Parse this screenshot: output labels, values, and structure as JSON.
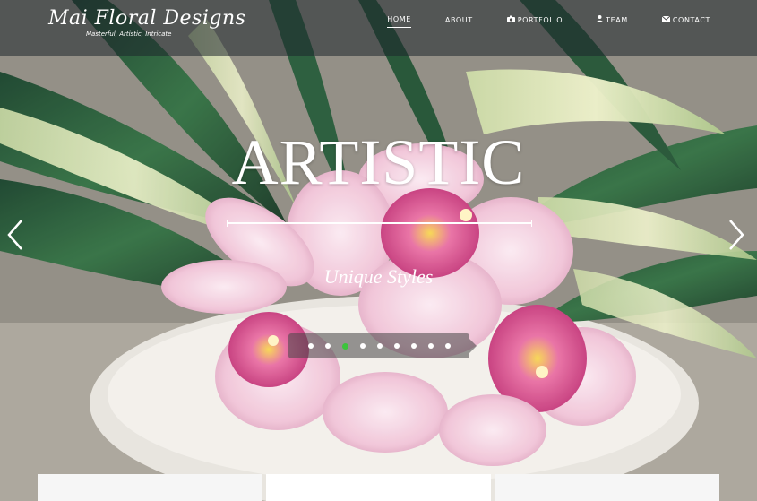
{
  "brand": {
    "name": "Mai Floral Designs",
    "tagline": "Masterful, Artistic, Intricate"
  },
  "nav": {
    "items": [
      {
        "label": "HOME",
        "icon": "",
        "active": true
      },
      {
        "label": "ABOUT",
        "icon": "",
        "active": false
      },
      {
        "label": "PORTFOLIO",
        "icon": "camera-icon",
        "active": false
      },
      {
        "label": "TEAM",
        "icon": "user-icon",
        "active": false
      },
      {
        "label": "CONTACT",
        "icon": "envelope-icon",
        "active": false
      }
    ]
  },
  "slider": {
    "title": "ARTISTIC",
    "subtitle": "Unique Styles",
    "total_slides": 9,
    "active_slide": 3,
    "colors": {
      "active_dot": "#3cc43c",
      "dot": "#ffffff"
    }
  },
  "cards": {
    "colors": [
      "#f6f6f6",
      "#ffffff",
      "#f6f6f6"
    ]
  },
  "theme": {
    "header_bg": "rgba(30,38,44,0.55)",
    "text": "#ffffff"
  }
}
